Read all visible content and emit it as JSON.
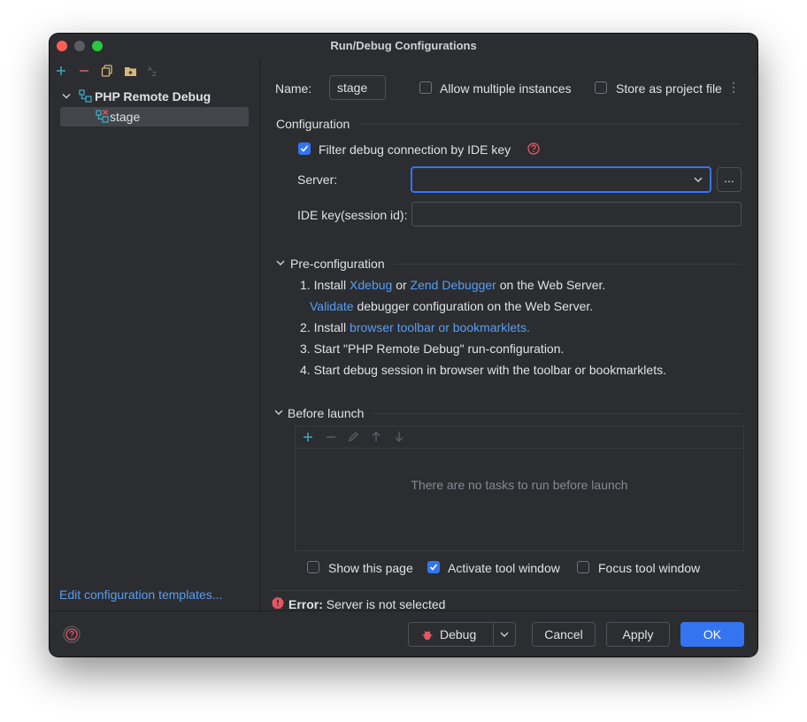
{
  "window": {
    "title": "Run/Debug Configurations"
  },
  "tree": {
    "group_label": "PHP Remote Debug",
    "item_label": "stage"
  },
  "sidebar_footer_link": "Edit configuration templates...",
  "name_row": {
    "name_label": "Name:",
    "name_value": "stage",
    "allow_multiple_label": "Allow multiple instances",
    "store_project_label": "Store as project file"
  },
  "configuration": {
    "section_title": "Configuration",
    "filter_label": "Filter debug connection by IDE key",
    "server_label": "Server:",
    "server_value": "",
    "browse_label": "...",
    "ide_key_label": "IDE key(session id):",
    "ide_key_value": ""
  },
  "preconfig": {
    "section_title": "Pre-configuration",
    "step1_prefix": "1. Install ",
    "step1_link1": "Xdebug",
    "step1_mid": " or ",
    "step1_link2": "Zend Debugger",
    "step1_suffix": " on the Web Server.",
    "validate_link": "Validate",
    "validate_suffix": " debugger configuration on the Web Server.",
    "step2_prefix": "2. Install ",
    "step2_link": "browser toolbar or bookmarklets.",
    "step3": "3. Start \"PHP Remote Debug\" run-configuration.",
    "step4": "4. Start debug session in browser with the toolbar or bookmarklets."
  },
  "before_launch": {
    "section_title": "Before launch",
    "empty_text": "There are no tasks to run before launch",
    "show_page_label": "Show this page",
    "activate_label": "Activate tool window",
    "focus_label": "Focus tool window"
  },
  "error": {
    "prefix": "Error:",
    "message": "Server is not selected"
  },
  "footer": {
    "debug_label": "Debug",
    "cancel_label": "Cancel",
    "apply_label": "Apply",
    "ok_label": "OK"
  },
  "colors": {
    "window_bg": "#2b2d30",
    "accent": "#3574f0",
    "link": "#589df6",
    "error": "#e55765",
    "add_icon": "#3fa9c4"
  }
}
